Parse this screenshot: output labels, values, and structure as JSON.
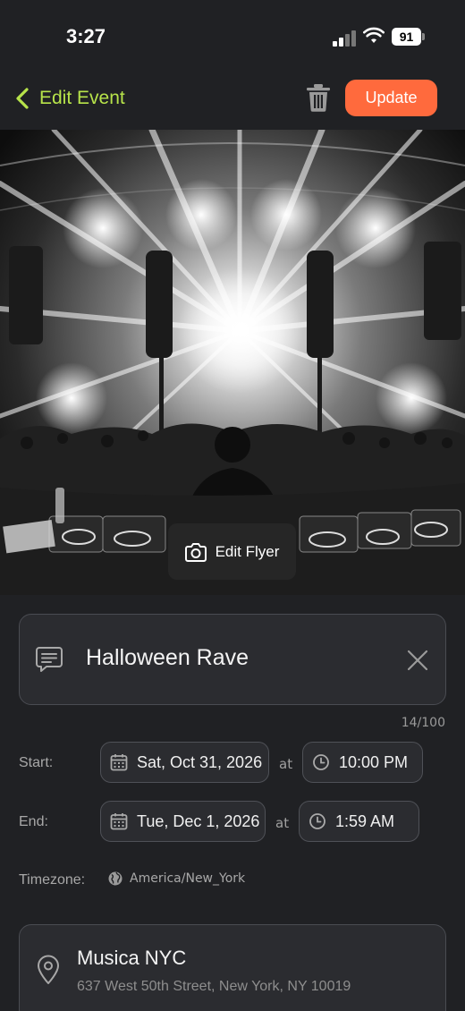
{
  "status": {
    "time": "3:27",
    "battery": "91"
  },
  "nav": {
    "title": "Edit Event",
    "update_label": "Update"
  },
  "flyer": {
    "edit_label": "Edit Flyer"
  },
  "event": {
    "name": "Halloween Rave",
    "char_count": "14/100"
  },
  "schedule": {
    "start_label": "Start:",
    "start_date": "Sat, Oct 31, 2026",
    "start_time": "10:00 PM",
    "end_label": "End:",
    "end_date": "Tue, Dec 1, 2026",
    "end_time": "1:59 AM",
    "at": "at"
  },
  "timezone": {
    "label": "Timezone:",
    "value": "America/New_York"
  },
  "location": {
    "name": "Musica NYC",
    "address": "637 West 50th Street, New York, NY 10019"
  },
  "colors": {
    "accent_green": "#b7e34a",
    "update_orange": "#ff6a3d",
    "background": "#202124"
  },
  "icons": [
    "chevron-left-icon",
    "trash-icon",
    "camera-icon",
    "text-bubble-icon",
    "close-icon",
    "calendar-icon",
    "clock-icon",
    "globe-icon",
    "location-pin-icon"
  ]
}
